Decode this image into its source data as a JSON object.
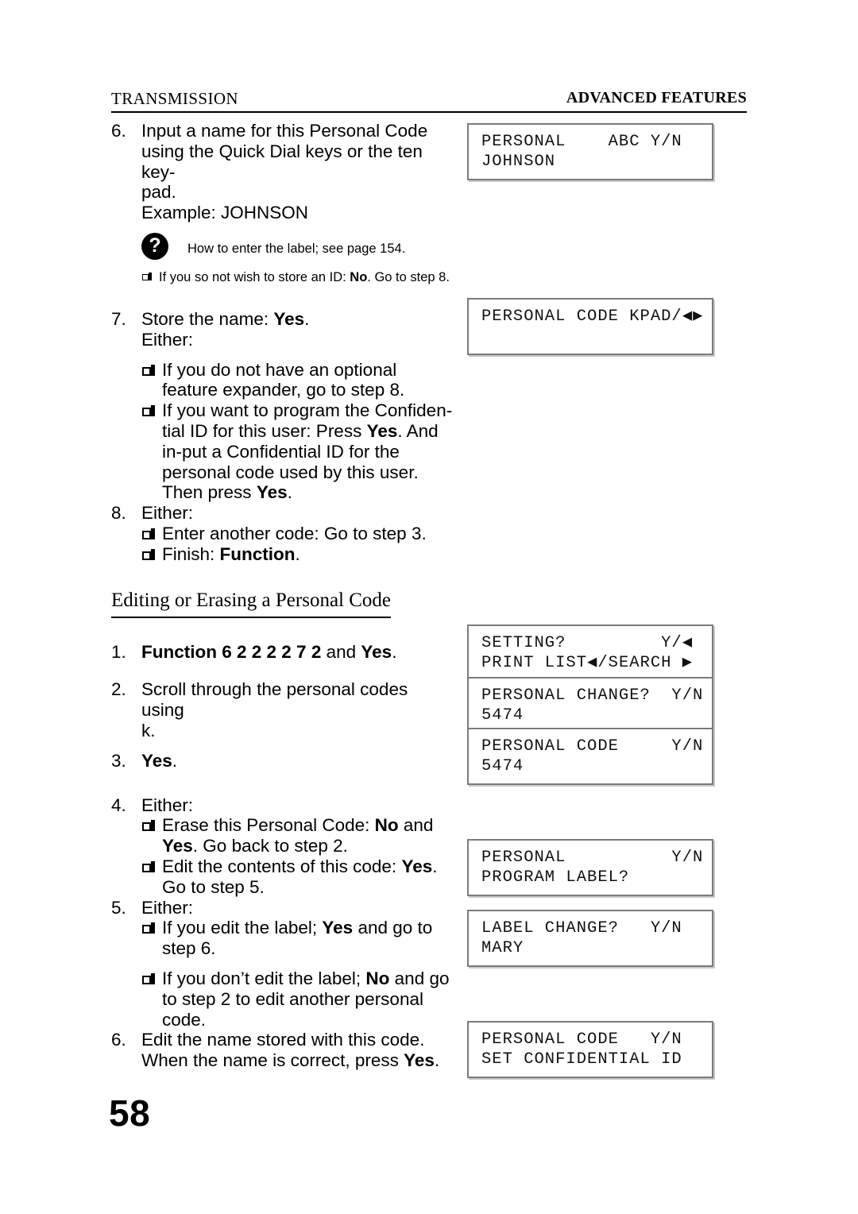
{
  "header": {
    "left": "TRANSMISSION",
    "right": "ADVANCED FEATURES"
  },
  "folio": "58",
  "steps_top": {
    "s6": {
      "num": "6.",
      "line1": "Input a name for this Personal Code",
      "line2": "using the Quick Dial keys or the ten key-",
      "line3": "pad.",
      "line4": "Example: JOHNSON"
    },
    "note_icon": "?",
    "note": "How to enter the label; see page 154.",
    "id_note_a": "If you so not wish to store an ID: ",
    "id_note_b": "No",
    "id_note_c": ". Go to step 8.",
    "s7": {
      "num": "7.",
      "line1a": "Store the name: ",
      "line1b": "Yes",
      "line1c": ".",
      "line2": "Either:",
      "b1": "If you do not have an optional feature expander, go to step 8.",
      "b2a": "If you want to program the Confiden-tial ID for this user: Press ",
      "b2b": "Yes",
      "b2c": ". And in-put a Confidential ID for the personal code used by this user. Then press ",
      "b2d": "Yes",
      "b2e": "."
    },
    "s8": {
      "num": "8.",
      "line1": "Either:",
      "b1": "Enter another code: Go to step 3.",
      "b2a": "Finish: ",
      "b2b": "Function",
      "b2c": "."
    }
  },
  "section": {
    "heading": "Editing or Erasing a Personal Code"
  },
  "steps_bottom": {
    "s1": {
      "num": "1.",
      "a": "Function 6 2 2 2 2 7 2",
      "b": " and ",
      "c": "Yes",
      "d": "."
    },
    "s2": {
      "num": "2.",
      "line1": "Scroll through the personal codes using",
      "line2": "k."
    },
    "s3": {
      "num": "3.",
      "a": "Yes",
      "b": "."
    },
    "s4": {
      "num": "4.",
      "line1": "Either:",
      "b1a": "Erase this Personal Code: ",
      "b1b": "No",
      "b1c": " and ",
      "b1d": "Yes",
      "b1e": ". Go back to step 2.",
      "b2a": "Edit the contents of this code: ",
      "b2b": "Yes",
      "b2c": ". Go to step 5."
    },
    "s5": {
      "num": "5.",
      "line1": "Either:",
      "b1a": "If you edit the label; ",
      "b1b": "Yes",
      "b1c": " and go to step 6.",
      "b2a": "If you don’t edit the label; ",
      "b2b": "No",
      "b2c": " and go to step 2 to edit another personal code."
    },
    "s6": {
      "num": "6.",
      "line1": "Edit the name stored with this code.",
      "line2a": "When the name is correct, press ",
      "line2b": "Yes",
      "line2c": "."
    }
  },
  "lcds": [
    {
      "id": "lcd-personal-abc",
      "line1": "PERSONAL    ABC Y/N",
      "line2": "JOHNSON"
    },
    {
      "id": "lcd-personal-code-kpad",
      "line1": "PERSONAL CODE KPAD/◀▶",
      "line2": ""
    },
    {
      "id": "lcd-setting",
      "line1": "SETTING?         Y/◀",
      "line2": "PRINT LIST◀/SEARCH ▶"
    },
    {
      "id": "lcd-personal-change",
      "line1": "PERSONAL CHANGE?  Y/N",
      "line2": "5474"
    },
    {
      "id": "lcd-personal-code-5474",
      "line1": "PERSONAL CODE     Y/N",
      "line2": "5474"
    },
    {
      "id": "lcd-program-label",
      "line1": "PERSONAL          Y/N",
      "line2": "PROGRAM LABEL?"
    },
    {
      "id": "lcd-label-change",
      "line1": "LABEL CHANGE?   Y/N",
      "line2": "MARY"
    },
    {
      "id": "lcd-set-confidential",
      "line1": "PERSONAL CODE   Y/N",
      "line2": "SET CONFIDENTIAL ID"
    }
  ]
}
